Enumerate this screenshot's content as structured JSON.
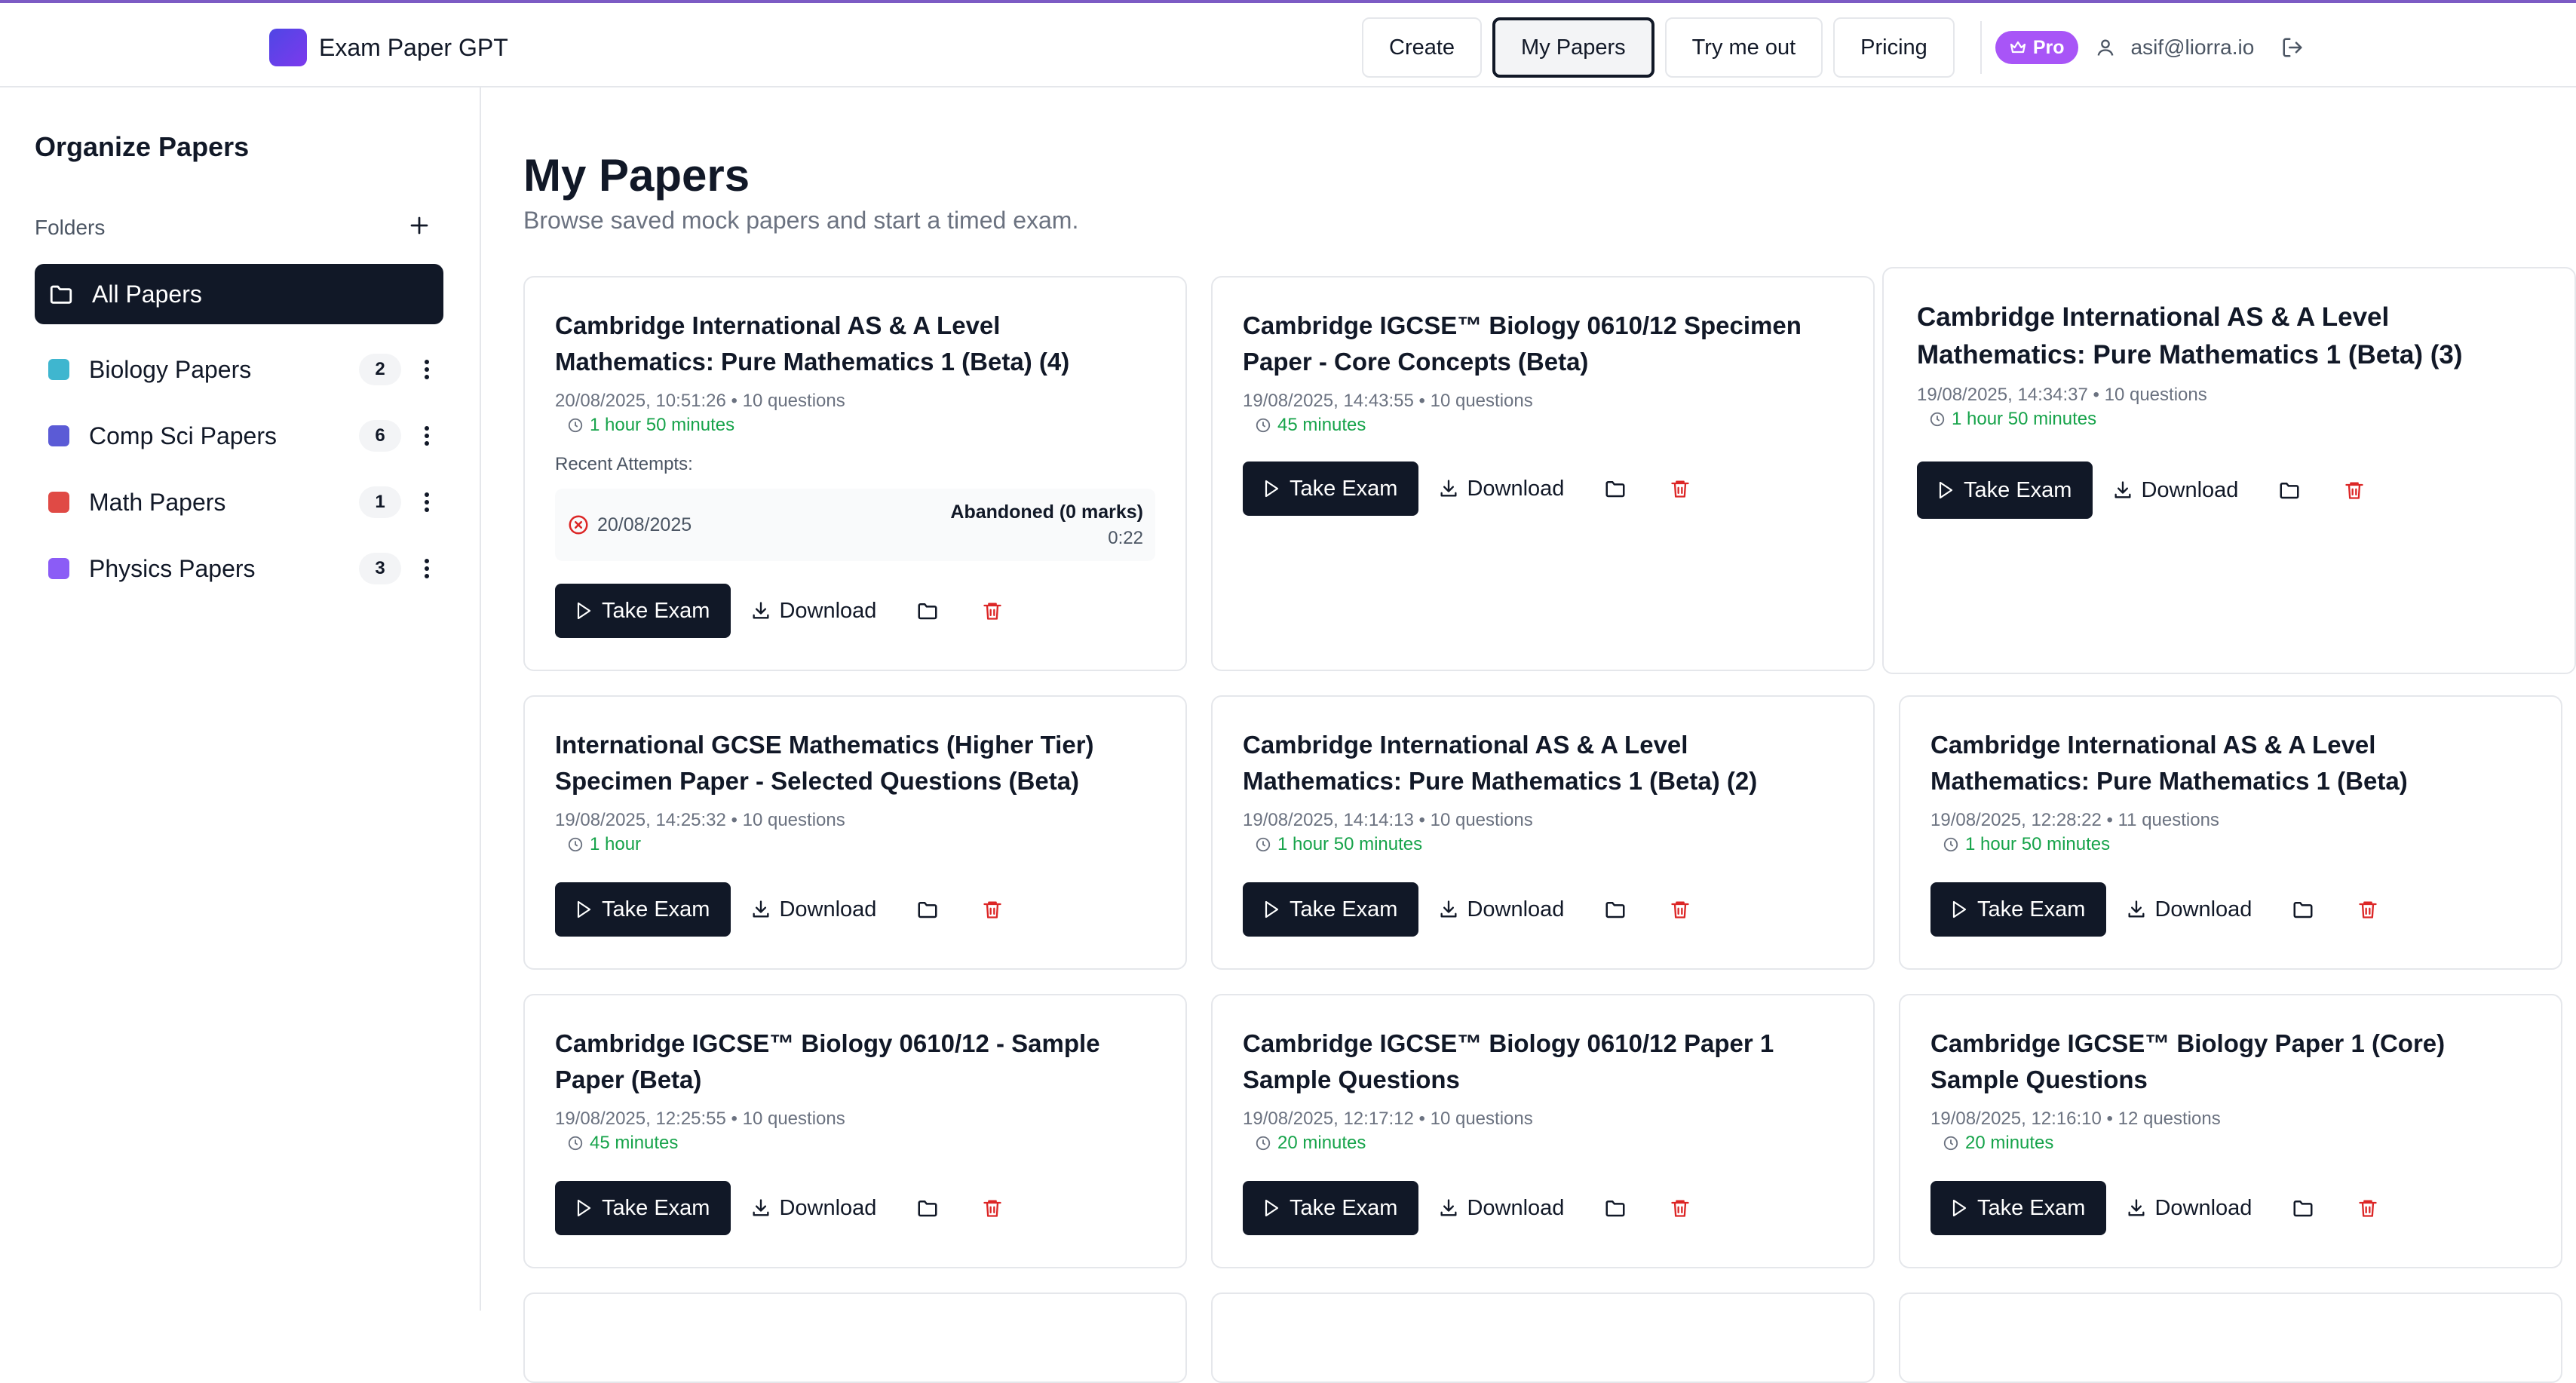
{
  "app": {
    "brand": "Exam Paper GPT"
  },
  "nav": {
    "items": [
      "Create",
      "My Papers",
      "Try me out",
      "Pricing"
    ],
    "active": "My Papers",
    "pro_label": "Pro",
    "user_email": "asif@liorra.io"
  },
  "sidebar": {
    "title": "Organize Papers",
    "folders_label": "Folders",
    "all_label": "All Papers",
    "folders": [
      {
        "name": "Biology Papers",
        "count": "2",
        "color": "#3fb6cf"
      },
      {
        "name": "Comp Sci Papers",
        "count": "6",
        "color": "#5b5bd6"
      },
      {
        "name": "Math Papers",
        "count": "1",
        "color": "#e04a45"
      },
      {
        "name": "Physics Papers",
        "count": "3",
        "color": "#8b5cf6"
      }
    ]
  },
  "main": {
    "title": "My Papers",
    "subtitle": "Browse saved mock papers and start a timed exam.",
    "take_exam_label": "Take Exam",
    "download_label": "Download",
    "recent_attempts_label": "Recent Attempts:"
  },
  "papers": [
    {
      "title": "Cambridge International AS & A Level Mathematics: Pure Mathematics 1 (Beta) (4)",
      "meta": "20/08/2025, 10:51:26 • 10 questions",
      "duration": "1 hour 50 minutes",
      "attempt": {
        "date": "20/08/2025",
        "status": "Abandoned (0 marks)",
        "time": "0:22"
      }
    },
    {
      "title": "Cambridge IGCSE™ Biology 0610/12 Specimen Paper - Core Concepts (Beta)",
      "meta": "19/08/2025, 14:43:55 • 10 questions",
      "duration": "45 minutes"
    },
    {
      "title": "Cambridge International AS & A Level Mathematics: Pure Mathematics 1 (Beta) (3)",
      "meta": "19/08/2025, 14:34:37 • 10 questions",
      "duration": "1 hour 50 minutes"
    },
    {
      "title": "International GCSE Mathematics (Higher Tier) Specimen Paper - Selected Questions (Beta)",
      "meta": "19/08/2025, 14:25:32 • 10 questions",
      "duration": "1 hour"
    },
    {
      "title": "Cambridge International AS & A Level Mathematics: Pure Mathematics 1 (Beta) (2)",
      "meta": "19/08/2025, 14:14:13 • 10 questions",
      "duration": "1 hour 50 minutes"
    },
    {
      "title": "Cambridge International AS & A Level Mathematics: Pure Mathematics 1 (Beta)",
      "meta": "19/08/2025, 12:28:22 • 11 questions",
      "duration": "1 hour 50 minutes"
    },
    {
      "title": "Cambridge IGCSE™ Biology 0610/12 - Sample Paper (Beta)",
      "meta": "19/08/2025, 12:25:55 • 10 questions",
      "duration": "45 minutes"
    },
    {
      "title": "Cambridge IGCSE™ Biology 0610/12 Paper 1 Sample Questions",
      "meta": "19/08/2025, 12:17:12 • 10 questions",
      "duration": "20 minutes"
    },
    {
      "title": "Cambridge IGCSE™ Biology Paper 1 (Core) Sample Questions",
      "meta": "19/08/2025, 12:16:10 • 12 questions",
      "duration": "20 minutes"
    }
  ]
}
